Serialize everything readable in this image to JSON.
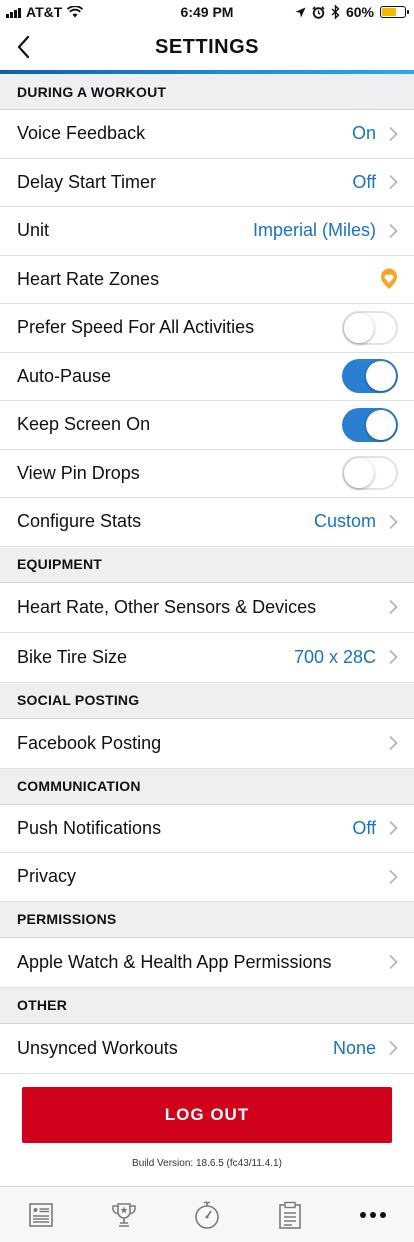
{
  "status_bar": {
    "carrier": "AT&T",
    "time": "6:49 PM",
    "battery": "60%"
  },
  "nav": {
    "title": "SETTINGS"
  },
  "colors": {
    "accent": "#1a72c6",
    "toggle_on": "#2a7fd1",
    "logout": "#d0021b"
  },
  "sections": {
    "workout": "DURING A WORKOUT",
    "equipment": "EQUIPMENT",
    "social": "SOCIAL POSTING",
    "communication": "COMMUNICATION",
    "permissions": "PERMISSIONS",
    "other": "OTHER"
  },
  "rows": {
    "voice_feedback": {
      "label": "Voice Feedback",
      "value": "On"
    },
    "delay_start": {
      "label": "Delay Start Timer",
      "value": "Off"
    },
    "unit": {
      "label": "Unit",
      "value": "Imperial (Miles)"
    },
    "hr_zones": {
      "label": "Heart Rate Zones",
      "icon": "hr-zones-badge-icon"
    },
    "prefer_speed": {
      "label": "Prefer Speed For All Activities",
      "on": false
    },
    "auto_pause": {
      "label": "Auto-Pause",
      "on": true
    },
    "keep_screen": {
      "label": "Keep Screen On",
      "on": true
    },
    "pin_drops": {
      "label": "View Pin Drops",
      "on": false
    },
    "configure_stats": {
      "label": "Configure Stats",
      "value": "Custom"
    },
    "sensors": {
      "label": "Heart Rate, Other Sensors & Devices"
    },
    "bike_tire": {
      "label": "Bike Tire Size",
      "value": "700 x 28C"
    },
    "facebook": {
      "label": "Facebook Posting"
    },
    "push": {
      "label": "Push Notifications",
      "value": "Off"
    },
    "privacy": {
      "label": "Privacy"
    },
    "apple_watch": {
      "label": "Apple Watch & Health App Permissions"
    },
    "unsynced": {
      "label": "Unsynced Workouts",
      "value": "None"
    }
  },
  "logout": {
    "label": "LOG OUT"
  },
  "build": "Build Version: 18.6.5 (fc43/11.4.1)",
  "tabs": [
    "feed-icon",
    "challenges-trophy-icon",
    "record-stopwatch-icon",
    "training-plan-clipboard-icon",
    "more-icon"
  ]
}
